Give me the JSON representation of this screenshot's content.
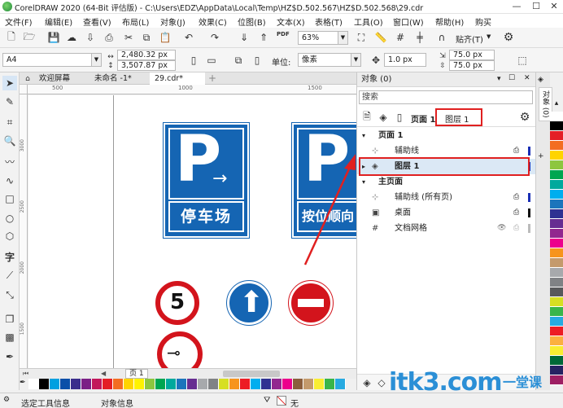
{
  "window": {
    "title": "CorelDRAW 2020 (64-Bit 评估版) - C:\\Users\\EDZ\\AppData\\Local\\Temp\\HZ$D.502.567\\HZ$D.502.568\\29.cdr"
  },
  "menu": [
    "文件(F)",
    "编辑(E)",
    "查看(V)",
    "布局(L)",
    "对象(J)",
    "效果(C)",
    "位图(B)",
    "文本(X)",
    "表格(T)",
    "工具(O)",
    "窗口(W)",
    "帮助(H)",
    "购买"
  ],
  "toolbar": {
    "zoom": "63%",
    "snap_label": "贴齐(T)",
    "pdf_label": "PDF"
  },
  "propbar": {
    "page_size": "A4",
    "width": "2,480.32 px",
    "height": "3,507.87 px",
    "unit_label": "单位:",
    "unit": "像素",
    "nudge": "1.0 px",
    "dup_x": "75.0 px",
    "dup_y": "75.0 px"
  },
  "tabs": [
    "欢迎屏幕",
    "未命名 -1*",
    "29.cdr*"
  ],
  "rulers": {
    "h": [
      "500",
      "1000",
      "1500"
    ],
    "v": [
      "3000",
      "2500",
      "2000",
      "1500"
    ]
  },
  "signs": {
    "parking_letter": "P",
    "parking_caption": "停车场",
    "parking2_caption": "按位顺向",
    "speed_limit": "5"
  },
  "page_tab": "页 1",
  "status": {
    "tool_info": "选定工具信息",
    "object_info": "对象信息",
    "fill": "无"
  },
  "docker": {
    "title": "对象 (0)",
    "search_placeholder": "搜索",
    "page_label": "页面 1",
    "layer_field": "图层 1",
    "tree": [
      {
        "label": "页面 1",
        "level": 0,
        "bold": true
      },
      {
        "label": "辅助线",
        "level": 1
      },
      {
        "label": "图层 1",
        "level": 1,
        "selected": true
      },
      {
        "label": "主页面",
        "level": 0,
        "bold": true
      },
      {
        "label": "辅助线 (所有页)",
        "level": 1
      },
      {
        "label": "桌面",
        "level": 1
      },
      {
        "label": "文档网格",
        "level": 1
      }
    ]
  },
  "vertical_tab": "对象 (0)",
  "watermark": {
    "text": "itk3.com",
    "cn": "一堂课"
  },
  "colors": {
    "sign_blue": "#1565b3",
    "sign_red": "#d3141c",
    "highlight": "#e02020",
    "palette": [
      "#ffffff",
      "#000000",
      "#00a0e0",
      "#0b4fa8",
      "#3b2e8c",
      "#7b1f86",
      "#c2185b",
      "#e41e26",
      "#f36d22",
      "#ffd400",
      "#fff200",
      "#8dc63f",
      "#00a651",
      "#00a99d",
      "#1b75bc",
      "#662d91",
      "#a7a9ac",
      "#808285",
      "#d7df23",
      "#f7941d",
      "#ed1c24",
      "#00aeef",
      "#2e3192",
      "#92278f",
      "#ec008c",
      "#8b5e3c",
      "#c49a6c",
      "#f9ed32",
      "#39b54a",
      "#27aae1"
    ],
    "right_palette": [
      "#ffffff",
      "#000000",
      "#e41e26",
      "#f36d22",
      "#ffd400",
      "#8dc63f",
      "#00a651",
      "#00a99d",
      "#00aeef",
      "#1b75bc",
      "#2e3192",
      "#662d91",
      "#92278f",
      "#ec008c",
      "#f7941d",
      "#c49a6c",
      "#a7a9ac",
      "#808285",
      "#58595b",
      "#d7df23",
      "#39b54a",
      "#27aae1",
      "#ed1c24",
      "#fbb040",
      "#f9ed32",
      "#006838",
      "#262262",
      "#9e1f63"
    ]
  }
}
